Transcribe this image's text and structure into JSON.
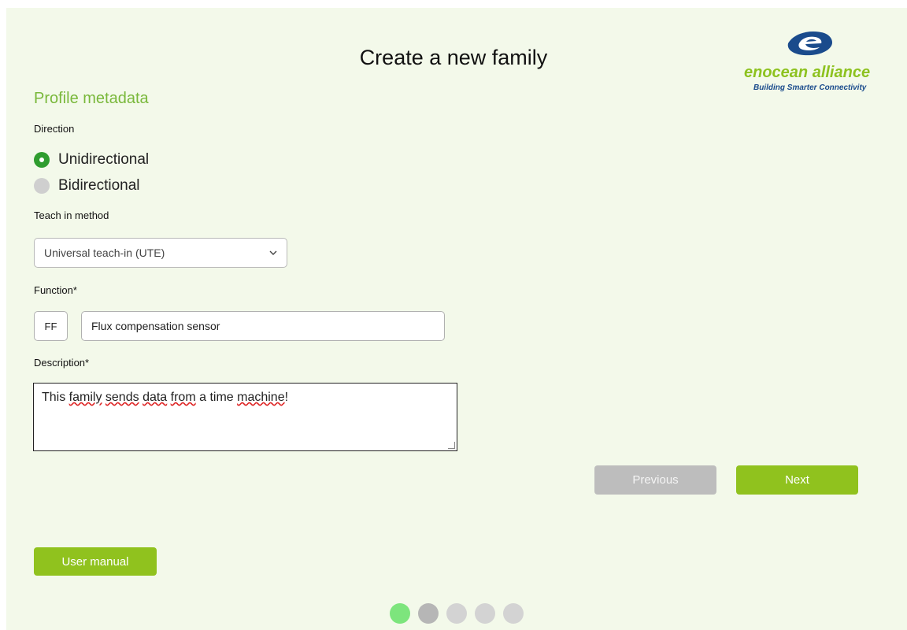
{
  "page": {
    "title": "Create a new family"
  },
  "logo": {
    "brand": "enocean alliance",
    "tagline": "Building Smarter Connectivity",
    "brand_color": "#8dc21f",
    "tagline_color": "#1a4b8c"
  },
  "form": {
    "section_title": "Profile metadata",
    "direction_label": "Direction",
    "direction_options": [
      {
        "label": "Unidirectional",
        "selected": true
      },
      {
        "label": "Bidirectional",
        "selected": false
      }
    ],
    "teach_in_label": "Teach in method",
    "teach_in_value": "Universal teach-in (UTE)",
    "function_label": "Function*",
    "function_code": "FF",
    "function_name": "Flux compensation sensor",
    "description_label": "Description*",
    "description_parts": [
      "This ",
      "family",
      " ",
      "sends",
      " ",
      "data",
      " ",
      "from",
      " a time ",
      "machine",
      "!"
    ]
  },
  "buttons": {
    "previous": "Previous",
    "next": "Next",
    "user_manual": "User manual"
  },
  "progress": {
    "steps": 5,
    "current": 1,
    "active_color": "#7de57d"
  },
  "colors": {
    "accent": "#90c21e",
    "section_title": "#79b83b",
    "radio_selected": "#2f9d2f",
    "background": "#f3f9ea"
  }
}
